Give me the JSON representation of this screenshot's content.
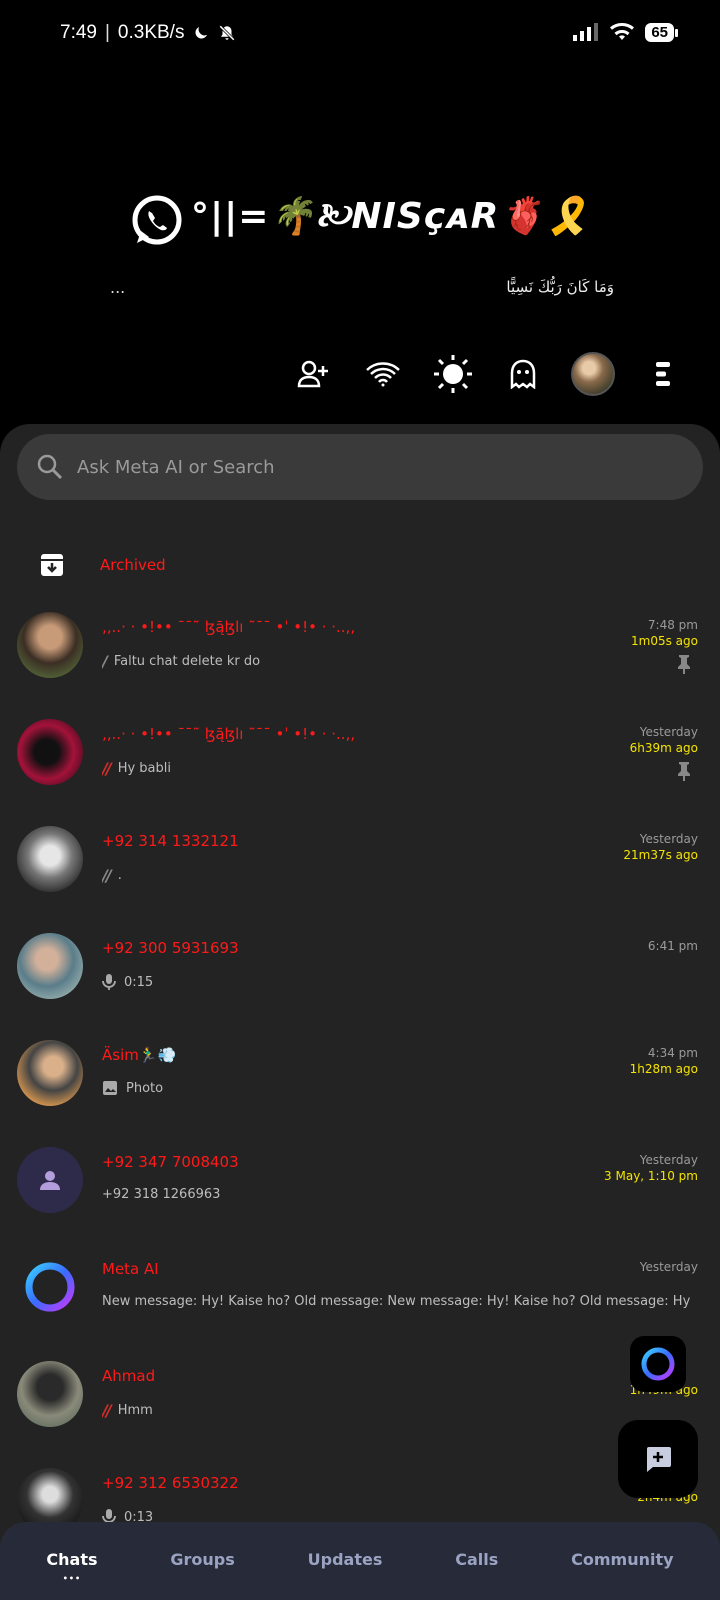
{
  "status_bar": {
    "time": "7:49",
    "speed": "0.3KB/s",
    "battery": "65"
  },
  "header": {
    "brand": "°||=🌴🙠NISçᴀR🫀🎗️",
    "dots": "...",
    "arabic_text": "وَمَا كَانَ رَبُّكَ نَسِيًّا"
  },
  "search": {
    "placeholder": "Ask Meta AI or Search"
  },
  "archived": {
    "label": "Archived"
  },
  "chats": [
    {
      "name": "‚‚..· · •!•• ¯ˉ˜ ɮą̄ɮlı ˜ˉ¯ •ˈ •!• · ·..‚‚",
      "message": "Faltu chat delete kr do",
      "time": "7:48 pm",
      "ago": "1m05s ago",
      "tick": "/",
      "pinned": true
    },
    {
      "name": "‚‚..· · •!•• ¯ˉ˜ ɮą̄ɮlı ˜ˉ¯ •ˈ •!• · ·..‚‚",
      "message": "Hy babli",
      "time": "Yesterday",
      "ago": "6h39m ago",
      "tick": "//",
      "pinned": true
    },
    {
      "name": "+92 314 1332121",
      "message": ".",
      "time": "Yesterday",
      "ago": "21m37s ago",
      "tick": "//"
    },
    {
      "name": "+92 300 5931693",
      "message": "0:15",
      "time": "6:41 pm",
      "ago": "",
      "tick": ""
    },
    {
      "name": "Äsim🏃‍♂️💨",
      "message": "Photo",
      "time": "4:34 pm",
      "ago": "1h28m ago",
      "tick": ""
    },
    {
      "name": "+92 347 7008403",
      "message": "+92 318 1266963",
      "time": "Yesterday",
      "ago": "3 May, 1:10 pm",
      "tick": ""
    },
    {
      "name": "Meta AI",
      "message": "New message: Hy! Kaise ho?  Old message: New message: Hy! Kaise ho?  Old message: Hy! Kais…",
      "time": "Yesterday",
      "ago": "",
      "tick": ""
    },
    {
      "name": "Ahmad",
      "message": "Hmm",
      "time": "",
      "ago": "1h49m ago",
      "tick": "//"
    },
    {
      "name": "+92 312 6530322",
      "message": "0:13",
      "time": "",
      "ago": "2h4m ago",
      "tick": ""
    }
  ],
  "bottom_nav": {
    "chats": "Chats",
    "groups": "Groups",
    "updates": "Updates",
    "calls": "Calls",
    "community": "Community"
  },
  "colors": {
    "accent_red": "#ff1a1a",
    "ago_yellow": "#f5e400",
    "panel_bg": "#232323",
    "nav_bg": "#272a39"
  }
}
